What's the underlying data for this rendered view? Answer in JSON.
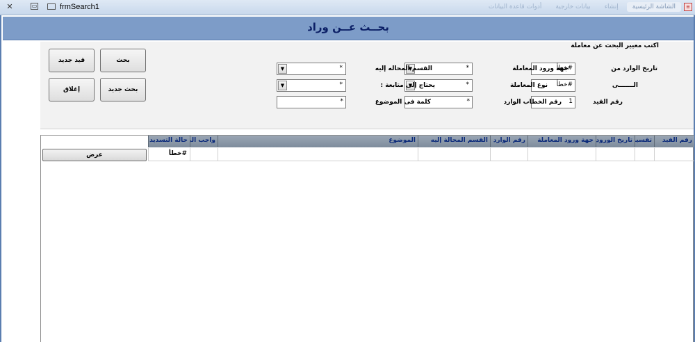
{
  "window": {
    "title": "frmSearch1",
    "taskbar_tabs": [
      "الشاشة الرئيسية",
      "إنشاء",
      "بيانات خارجية",
      "أدوات قاعدة البيانات"
    ]
  },
  "header": {
    "title": "بحــث عــن وراد"
  },
  "criteria": {
    "hint": "اكتب معيير البحث عن معاملة",
    "date_from_label": "تاريخ الوارد من",
    "date_from_value": "#خطأ",
    "date_to_label": "الـــــــى",
    "date_to_value": "#خطأ",
    "reg_no_label": "رقم القيد",
    "reg_no_value": "1",
    "source_label": "جهة ورود المعاملة",
    "source_value": "*",
    "type_label": "نوع المعاملة",
    "type_value": "*",
    "letter_no_label": "رقم الخطاب الوارد",
    "letter_no_value": "*",
    "dept_label": "القسم المحاله إليه",
    "dept_value": "*",
    "followup_label": "يحتاج إلى متابعة :",
    "followup_value": "*",
    "keyword_label": "كلمة فى الموضوع",
    "keyword_value": "*"
  },
  "buttons": {
    "search": "بحث",
    "new_record": "قيد جديد",
    "new_search": "بحث جديد",
    "close": "إغلاق"
  },
  "grid": {
    "columns": [
      "رقم القيد",
      "تقسيم",
      "تاريخ الورود",
      "جهة ورود المعاملة",
      "رقم الوارد",
      "القسم المحالة إليه",
      "الموضوع",
      "واجب الرد",
      "حالة التسديد"
    ],
    "row": [
      "",
      "",
      "",
      "",
      "",
      "",
      "",
      "",
      "#خطأ"
    ],
    "show_button": "عرض"
  }
}
